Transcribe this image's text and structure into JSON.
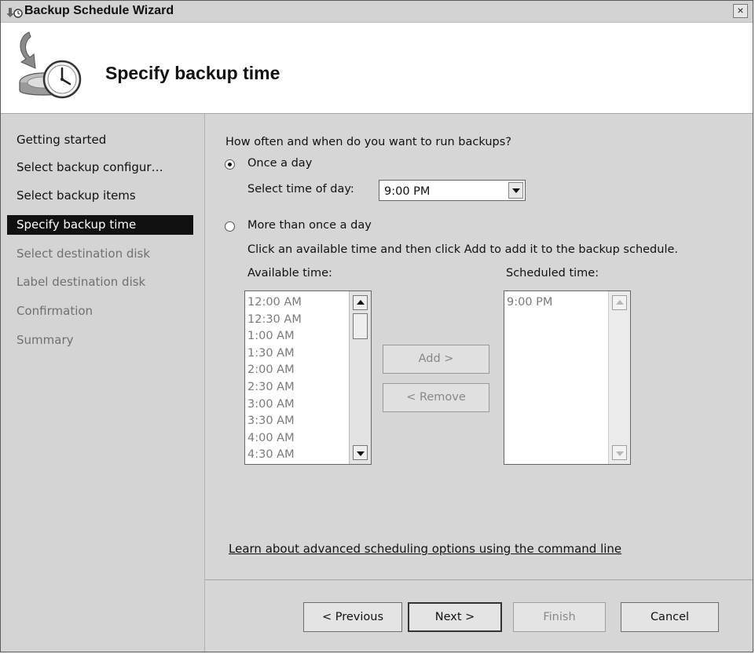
{
  "window": {
    "title": "Backup Schedule Wizard",
    "close_label": "×"
  },
  "header": {
    "title": "Specify backup time",
    "icon": "backup-clock-icon"
  },
  "sidebar": {
    "steps": [
      {
        "label": "Getting started",
        "state": "enabled"
      },
      {
        "label": "Select backup configur…",
        "state": "enabled"
      },
      {
        "label": "Select backup items",
        "state": "enabled"
      },
      {
        "label": "Specify backup time",
        "state": "active"
      },
      {
        "label": "Select destination disk",
        "state": "disabled"
      },
      {
        "label": "Label destination disk",
        "state": "disabled"
      },
      {
        "label": "Confirmation",
        "state": "disabled"
      },
      {
        "label": "Summary",
        "state": "disabled"
      }
    ]
  },
  "main": {
    "question": "How often and when do you want to run backups?",
    "once_a_day": {
      "label": "Once a day",
      "checked": true
    },
    "time_of_day": {
      "label": "Select time of day:",
      "value": "9:00 PM"
    },
    "more_than_once": {
      "label": "More than once a day",
      "checked": false
    },
    "instruction": "Click an available time and then click Add to add it to the backup schedule.",
    "available": {
      "label": "Available time:",
      "items": [
        "12:00 AM",
        "12:30 AM",
        "1:00 AM",
        "1:30 AM",
        "2:00 AM",
        "2:30 AM",
        "3:00 AM",
        "3:30 AM",
        "4:00 AM",
        "4:30 AM"
      ]
    },
    "scheduled": {
      "label": "Scheduled time:",
      "items": [
        "9:00 PM"
      ]
    },
    "add_label": "Add >",
    "remove_label": "< Remove",
    "link": "Learn about advanced scheduling options using the command line"
  },
  "footer": {
    "previous": "< Previous",
    "next": "Next >",
    "finish": "Finish",
    "cancel": "Cancel"
  },
  "colors": {
    "dialog_bg": "#d6d6d6",
    "active_step_bg": "#111111",
    "disabled_text": "#707070"
  }
}
